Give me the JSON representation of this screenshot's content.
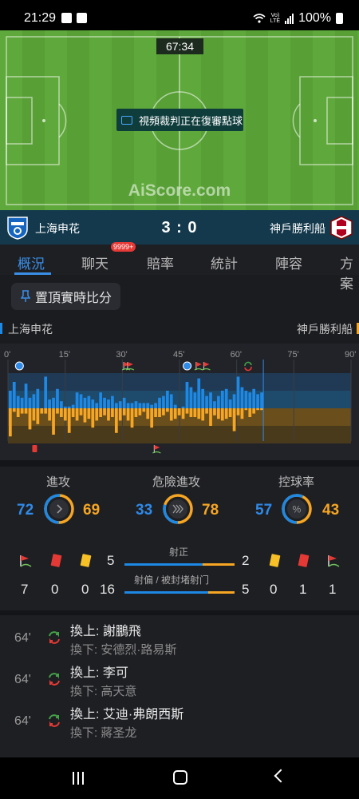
{
  "status_bar": {
    "time": "21:29",
    "battery": "100%",
    "network": "VoLTE"
  },
  "pitch": {
    "clock": "67:34",
    "var_text": "視頻裁判正在復審點球",
    "watermark": "AiScore.com"
  },
  "scoreboard": {
    "home": "上海申花",
    "away": "神戶勝利船",
    "score": "3 : 0"
  },
  "tabs": {
    "items": [
      "概況",
      "聊天",
      "賠率",
      "統計",
      "陣容",
      "方案"
    ],
    "active": "概況",
    "chat_badge": "9999+"
  },
  "pin_button": "置頂實時比分",
  "teams": {
    "home": "上海申花",
    "away": "神戶勝利船"
  },
  "timeline": {
    "ticks": [
      "0'",
      "15'",
      "30'",
      "45'",
      "60'",
      "75'",
      "90'"
    ],
    "current_minute": 67,
    "home_events": [
      {
        "minute": 3,
        "type": "ball-icon"
      },
      {
        "minute": 31,
        "type": "corner-icon"
      },
      {
        "minute": 32,
        "type": "corner-icon"
      },
      {
        "minute": 47,
        "type": "ball-icon"
      },
      {
        "minute": 50,
        "type": "corner-icon"
      },
      {
        "minute": 52,
        "type": "corner-icon"
      },
      {
        "minute": 63,
        "type": "substitution-icon"
      }
    ],
    "away_events": [
      {
        "minute": 7,
        "type": "red-card-icon"
      },
      {
        "minute": 39,
        "type": "corner-icon"
      }
    ],
    "home_pressure": [
      0.5,
      0.75,
      0.35,
      0.3,
      0.7,
      0.3,
      0.4,
      0.55,
      0,
      0.9,
      0.25,
      0.3,
      0.55,
      0.2,
      0.05,
      0.05,
      0.1,
      0.45,
      0.4,
      0.3,
      0.35,
      0.25,
      0.15,
      0.45,
      0.3,
      0.25,
      0.35,
      0.15,
      0.2,
      0.3,
      0.15,
      0.15,
      0.2,
      0.15,
      0.15,
      0.15,
      0.1,
      0.15,
      0.3,
      0.35,
      0.5,
      0.4,
      0.1,
      0,
      0.05,
      0.75,
      0.6,
      0.45,
      0.85,
      0.55,
      0.35,
      0.45,
      0.2,
      0.35,
      0.5,
      0.55,
      0.25,
      0.4,
      0.9,
      0.6,
      0.5,
      0.45,
      0.55,
      0.4,
      0.45
    ],
    "away_pressure": [
      0.8,
      0.1,
      0.25,
      0.15,
      0.15,
      0.6,
      0.35,
      0.45,
      0.15,
      0.15,
      0.35,
      0.75,
      0.15,
      0.25,
      0.35,
      0.7,
      0.25,
      0.35,
      0.2,
      0.4,
      0.3,
      0.55,
      0.35,
      0.25,
      0.2,
      0.35,
      0.25,
      0.7,
      0.35,
      0.2,
      0.35,
      0.55,
      0.25,
      0.2,
      0.1,
      0.3,
      0.55,
      0.25,
      0.25,
      0.2,
      0.1,
      0.35,
      0.3,
      0.2,
      0.3,
      0.15,
      0.25,
      0.25,
      0.3,
      0.35,
      0.15,
      0.5,
      0.2,
      0.3,
      0.35,
      0.3,
      0.25,
      0.65,
      0.2,
      0.3,
      0.05,
      0.25,
      0.15,
      0.05,
      0.05
    ]
  },
  "stats": {
    "attacks": {
      "label": "進攻",
      "home": "72",
      "away": "69",
      "home_share": 0.51
    },
    "dangerous": {
      "label": "危險進攻",
      "home": "33",
      "away": "78",
      "home_share": 0.3
    },
    "possession": {
      "label": "控球率",
      "home": "57",
      "away": "43",
      "home_share": 0.57
    },
    "home_corners": "7",
    "home_red": "0",
    "home_yellow": "0",
    "away_yellow": "0",
    "away_red": "1",
    "away_corners": "1",
    "on_target": {
      "label": "射正",
      "home": "5",
      "away": "2",
      "home_share": 0.71
    },
    "off_target": {
      "label": "射偏 / 被封堵射门",
      "home": "16",
      "away": "5",
      "home_share": 0.76
    }
  },
  "events": [
    {
      "minute": "64'",
      "in": "換上: 謝鵬飛",
      "out": "換下: 安德烈·路易斯"
    },
    {
      "minute": "64'",
      "in": "換上: 李可",
      "out": "換下: 高天意"
    },
    {
      "minute": "64'",
      "in": "換上: 艾迪·弗朗西斯",
      "out": "換下: 蔣圣龙"
    }
  ],
  "colors": {
    "home": "#1e88e5",
    "away": "#f6a623",
    "accent": "#3a8ee6",
    "pitch": "#5fa83b"
  }
}
